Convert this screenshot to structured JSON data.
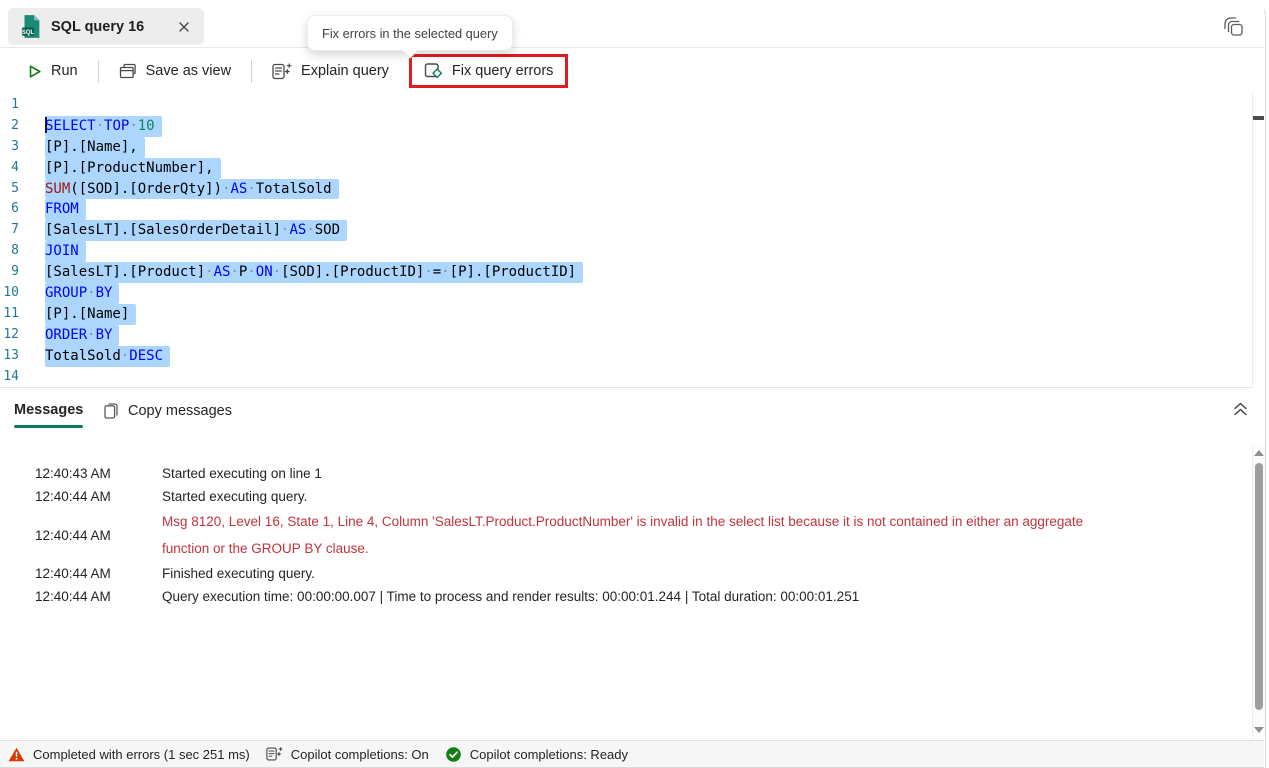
{
  "tab": {
    "title": "SQL query 16",
    "badge": "SQL"
  },
  "tooltip": {
    "text": "Fix errors in the selected query"
  },
  "toolbar": {
    "run": "Run",
    "save_as_view": "Save as view",
    "explain_query": "Explain query",
    "fix_query_errors": "Fix query errors"
  },
  "editor": {
    "selection_color": "#ADD6FF",
    "lines": [
      {
        "n": "1",
        "sel": false,
        "tokens": []
      },
      {
        "n": "2",
        "sel": true,
        "cursor": true,
        "tokens": [
          {
            "t": "SELECT",
            "c": "k"
          },
          {
            "t": "·",
            "c": "s"
          },
          {
            "t": "TOP",
            "c": "k"
          },
          {
            "t": "·",
            "c": "s"
          },
          {
            "t": "10",
            "c": "n"
          }
        ]
      },
      {
        "n": "3",
        "sel": true,
        "tokens": [
          {
            "t": "[P].[Name],",
            "c": "p"
          }
        ]
      },
      {
        "n": "4",
        "sel": true,
        "tokens": [
          {
            "t": "[P].[ProductNumber],",
            "c": "p"
          }
        ]
      },
      {
        "n": "5",
        "sel": true,
        "tokens": [
          {
            "t": "SUM",
            "c": "f"
          },
          {
            "t": "([SOD].[OrderQty])",
            "c": "p"
          },
          {
            "t": "·",
            "c": "s"
          },
          {
            "t": "AS",
            "c": "k"
          },
          {
            "t": "·",
            "c": "s"
          },
          {
            "t": "TotalSold",
            "c": "p"
          }
        ]
      },
      {
        "n": "6",
        "sel": true,
        "tokens": [
          {
            "t": "FROM",
            "c": "k"
          }
        ]
      },
      {
        "n": "7",
        "sel": true,
        "tokens": [
          {
            "t": "[SalesLT].[SalesOrderDetail]",
            "c": "p"
          },
          {
            "t": "·",
            "c": "s"
          },
          {
            "t": "AS",
            "c": "k"
          },
          {
            "t": "·",
            "c": "s"
          },
          {
            "t": "SOD",
            "c": "p"
          }
        ]
      },
      {
        "n": "8",
        "sel": true,
        "tokens": [
          {
            "t": "JOIN",
            "c": "k"
          }
        ]
      },
      {
        "n": "9",
        "sel": true,
        "tokens": [
          {
            "t": "[SalesLT].[Product]",
            "c": "p"
          },
          {
            "t": "·",
            "c": "s"
          },
          {
            "t": "AS",
            "c": "k"
          },
          {
            "t": "·",
            "c": "s"
          },
          {
            "t": "P",
            "c": "p"
          },
          {
            "t": "·",
            "c": "s"
          },
          {
            "t": "ON",
            "c": "k"
          },
          {
            "t": "·",
            "c": "s"
          },
          {
            "t": "[SOD].[ProductID]",
            "c": "p"
          },
          {
            "t": "·",
            "c": "s"
          },
          {
            "t": "=",
            "c": "p"
          },
          {
            "t": "·",
            "c": "s"
          },
          {
            "t": "[P].[ProductID]",
            "c": "p"
          }
        ]
      },
      {
        "n": "10",
        "sel": true,
        "tokens": [
          {
            "t": "GROUP",
            "c": "k"
          },
          {
            "t": "·",
            "c": "s"
          },
          {
            "t": "BY",
            "c": "k"
          }
        ]
      },
      {
        "n": "11",
        "sel": true,
        "tokens": [
          {
            "t": "[P].[Name]",
            "c": "p"
          }
        ]
      },
      {
        "n": "12",
        "sel": true,
        "tokens": [
          {
            "t": "ORDER",
            "c": "k"
          },
          {
            "t": "·",
            "c": "s"
          },
          {
            "t": "BY",
            "c": "k"
          }
        ]
      },
      {
        "n": "13",
        "sel": true,
        "tokens": [
          {
            "t": "TotalSold",
            "c": "p"
          },
          {
            "t": "·",
            "c": "s"
          },
          {
            "t": "DESC",
            "c": "k"
          }
        ]
      },
      {
        "n": "14",
        "sel": false,
        "tokens": []
      }
    ]
  },
  "messages_panel": {
    "tab": "Messages",
    "copy_button": "Copy messages",
    "rows": [
      {
        "time": "12:40:43 AM",
        "text": "Started executing on line 1",
        "type": "info"
      },
      {
        "time": "12:40:44 AM",
        "text": "Started executing query.",
        "type": "info"
      },
      {
        "time": "12:40:44 AM",
        "text": "Msg 8120, Level 16, State 1, Line 4, Column 'SalesLT.Product.ProductNumber' is invalid in the select list because it is not contained in either an aggregate function or the GROUP BY clause.",
        "type": "error"
      },
      {
        "time": "12:40:44 AM",
        "text": "Finished executing query.",
        "type": "info"
      },
      {
        "time": "12:40:44 AM",
        "text": "Query execution time: 00:00:00.007 | Time to process and render results: 00:00:01.244 | Total duration: 00:00:01.251",
        "type": "info"
      }
    ]
  },
  "status_bar": {
    "completed": "Completed with errors (1 sec 251 ms)",
    "copilot_on": "Copilot completions: On",
    "copilot_ready": "Copilot completions: Ready"
  },
  "colors": {
    "keyword": "#0000FF",
    "number": "#098658",
    "function": "#A31515",
    "selection": "#ADD6FF",
    "line_number": "#237893",
    "error_text": "#C1343B",
    "accent_teal": "#117865",
    "alert_border_red": "#E11D23",
    "run_green": "#107C10",
    "warning_orange": "#D83B01",
    "success_green": "#118011"
  },
  "icons": [
    "sql-file-icon",
    "close-icon",
    "copy-stack-icon",
    "run-icon",
    "save-as-view-icon",
    "explain-query-icon",
    "fix-query-errors-icon",
    "copy-icon",
    "collapse-panel-icon",
    "warning-icon",
    "copilot-icon",
    "ready-check-icon",
    "scroll-up-icon",
    "scroll-down-icon"
  ]
}
